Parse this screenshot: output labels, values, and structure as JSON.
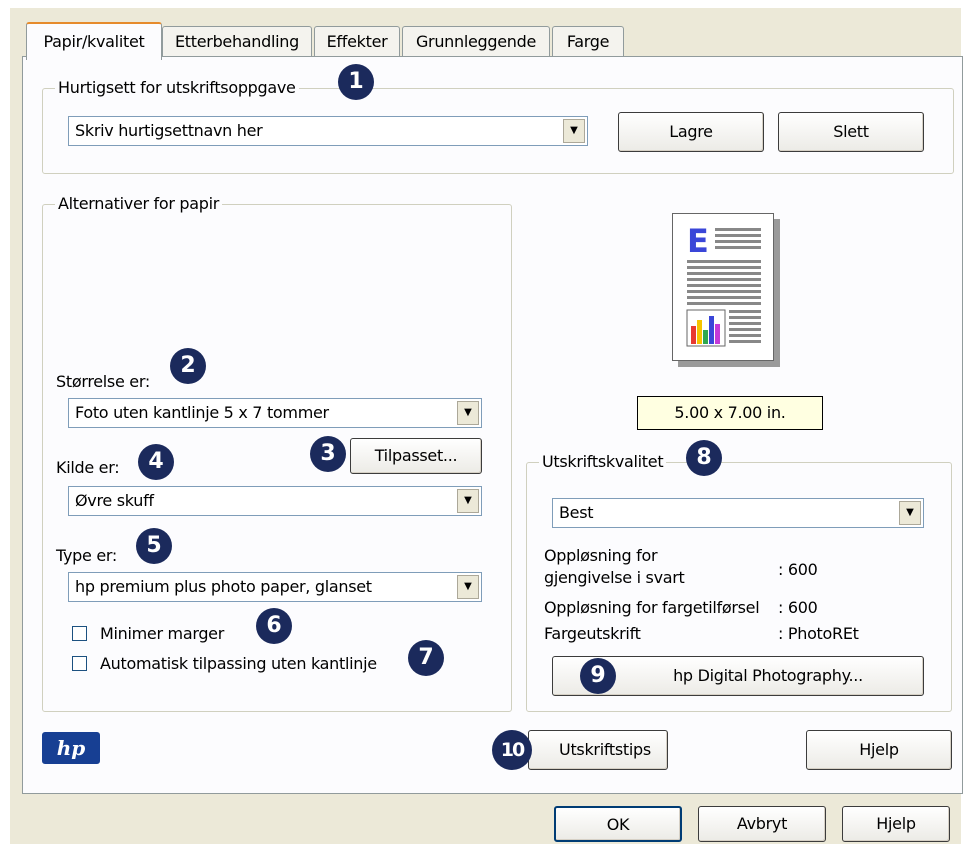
{
  "tabs": [
    "Papir/kvalitet",
    "Etterbehandling",
    "Effekter",
    "Grunnleggende",
    "Farge"
  ],
  "quickset": {
    "group_label": "Hurtigsett for utskriftsoppgave",
    "combo_value": "Skriv hurtigsettnavn her",
    "save_label": "Lagre",
    "delete_label": "Slett"
  },
  "paper": {
    "group_label": "Alternativer for papir",
    "size_label": "Størrelse er:",
    "size_value": "Foto uten kantlinje 5 x 7 tommer",
    "custom_label": "Tilpasset...",
    "source_label": "Kilde er:",
    "source_value": "Øvre skuff",
    "type_label": "Type er:",
    "type_value": "hp premium plus photo paper, glanset",
    "min_margins_label": "Minimer marger",
    "auto_borderless_label": "Automatisk tilpassing uten kantlinje"
  },
  "preview": {
    "size_text": "5.00 x 7.00 in.",
    "page_letter": "E"
  },
  "quality": {
    "group_label": "Utskriftskvalitet",
    "combo_value": "Best",
    "black_res_label_1": "Oppløsning for",
    "black_res_label_2": "gjengivelse i svart",
    "black_res_value": ": 600",
    "color_res_label": "Oppløsning for fargetilførsel",
    "color_res_value": ": 600",
    "color_output_label": "Fargeutskrift",
    "color_output_value": ": PhotoREt",
    "digital_photo_label": "hp Digital Photography..."
  },
  "bottom": {
    "logo_text": "hp",
    "tips_label": "Utskriftstips",
    "help_label": "Hjelp"
  },
  "dialog_buttons": {
    "ok": "OK",
    "cancel": "Avbryt",
    "help": "Hjelp"
  },
  "badges": [
    "1",
    "2",
    "3",
    "4",
    "5",
    "6",
    "7",
    "8",
    "9",
    "10"
  ],
  "colors": {
    "badge": "#1b2a5c",
    "logo": "#173f93",
    "tooltip_bg": "#ffffe1",
    "tab_highlight": "#e68b2c"
  }
}
